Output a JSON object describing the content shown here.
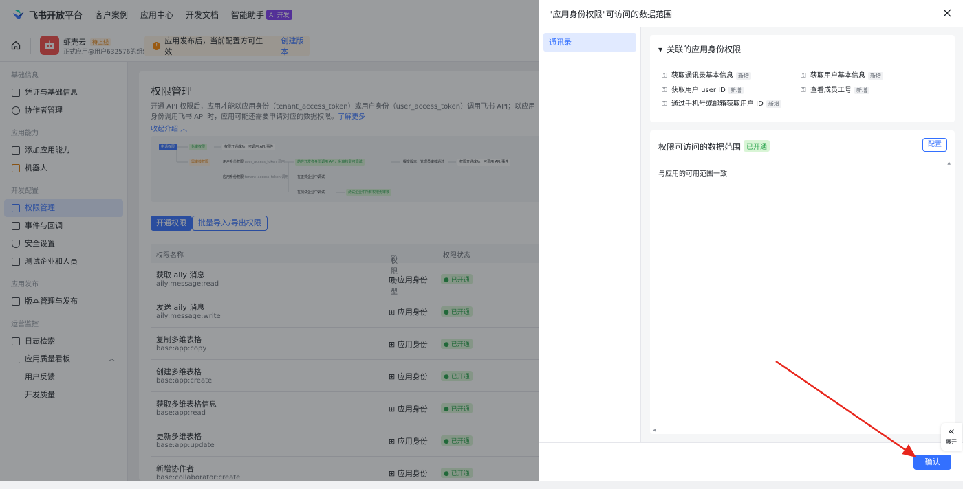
{
  "topnav": {
    "brand": "飞书开放平台",
    "items": [
      "客户案例",
      "应用中心",
      "开发文档",
      "智能助手"
    ],
    "ai_badge": "AI 开发"
  },
  "app": {
    "name": "虾壳云",
    "status": "待上线",
    "desc": "正式应用@用户632576的组织",
    "notice": "应用发布后，当前配置方可生效",
    "notice_link": "创建版本"
  },
  "sidebar": {
    "g1": "基础信息",
    "i1": "凭证与基础信息",
    "i2": "协作者管理",
    "g2": "应用能力",
    "i3": "添加应用能力",
    "i4": "机器人",
    "g3": "开发配置",
    "i5": "权限管理",
    "i6": "事件与回调",
    "i7": "安全设置",
    "i8": "测试企业和人员",
    "g4": "应用发布",
    "i9": "版本管理与发布",
    "g5": "运营监控",
    "i10": "日志检索",
    "i11": "应用质量看板",
    "s1": "用户反馈",
    "s2": "开发质量"
  },
  "main": {
    "title": "权限管理",
    "intro": "开通 API 权限后，应用才能以应用身份（tenant_access_token）或用户身份（user_access_token）调用飞书 API；以应用身份调用飞书 API 时，应用可能还需要申请对应的数据权限。",
    "learn_more": "了解更多",
    "collapse": "收起介绍",
    "flow": {
      "a": "申请权限",
      "b": "免审权限",
      "c": "权限开通成功，可调用 API/事件",
      "d": "需审核权限",
      "e": "用户身份权限",
      "f": "user_access_token 调用",
      "g": "站在开发者身份调用 API，免审核即可调试",
      "h": "提交版本，管理员审核通过",
      "i": "权限开通成功，可调用 API/事件",
      "j": "应用身份权限",
      "k": "tenant_access_token 调用",
      "l": "在正式企业中调试",
      "m": "在测试企业中调试",
      "n": "测试企业中所有权限免审核"
    },
    "btn_open": "开通权限",
    "btn_import": "批量导入/导出权限",
    "cols": {
      "name": "权限名称",
      "type": "权限类型",
      "status": "权限状态"
    },
    "rows": [
      {
        "name": "获取 aily 消息",
        "code": "aily:message:read",
        "type": "应用身份",
        "status": "已开通"
      },
      {
        "name": "发送 aily 消息",
        "code": "aily:message:write",
        "type": "应用身份",
        "status": "已开通"
      },
      {
        "name": "复制多维表格",
        "code": "base:app:copy",
        "type": "应用身份",
        "status": "已开通"
      },
      {
        "name": "创建多维表格",
        "code": "base:app:create",
        "type": "应用身份",
        "status": "已开通"
      },
      {
        "name": "获取多维表格信息",
        "code": "base:app:read",
        "type": "应用身份",
        "status": "已开通"
      },
      {
        "name": "更新多维表格",
        "code": "base:app:update",
        "type": "应用身份",
        "status": "已开通"
      },
      {
        "name": "新增协作者",
        "code": "base:collaborator:create",
        "type": "应用身份",
        "status": "已开通"
      }
    ]
  },
  "panel": {
    "title": "\"应用身份权限\"可访问的数据范围",
    "nav": "通讯录",
    "assoc_title": "关联的应用身份权限",
    "new_tag": "新增",
    "perms": [
      "获取通讯录基本信息",
      "获取用户基本信息",
      "获取用户 user ID",
      "查看成员工号",
      "通过手机号或邮箱获取用户 ID"
    ],
    "scope_title": "权限可访问的数据范围",
    "scope_status": "已开通",
    "config": "配置",
    "scope_text": "与应用的可用范围一致",
    "confirm": "确认",
    "expand": "展开"
  },
  "colors": {
    "primary": "#3370ff",
    "success": "#24a148",
    "annotation_arrow": "#e8261c"
  }
}
